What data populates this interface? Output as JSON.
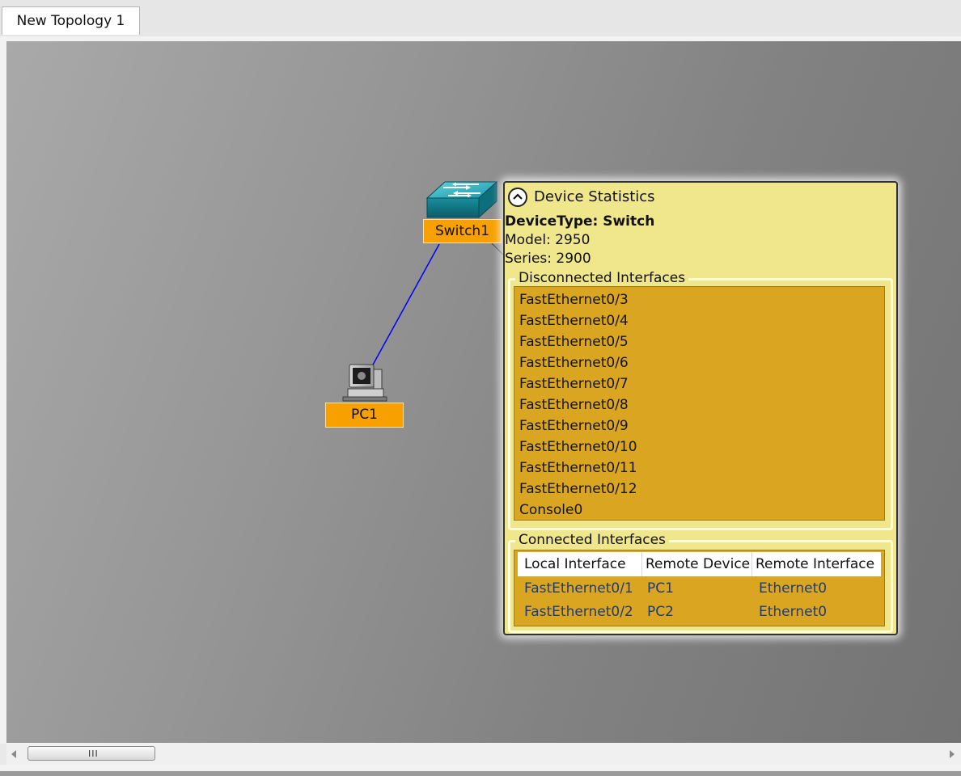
{
  "tabs": [
    {
      "label": "New Topology 1"
    }
  ],
  "devices": {
    "switch": {
      "label": "Switch1",
      "icon": "switch-icon"
    },
    "pc": {
      "label": "PC1",
      "icon": "pc-icon"
    }
  },
  "link": {
    "color": "#0000ff"
  },
  "stats_panel": {
    "title": "Device Statistics",
    "device_type_label": "DeviceType: Switch",
    "model_label": "Model: 2950",
    "series_label": "Series: 2900",
    "disconnected": {
      "title": "Disconnected Interfaces",
      "items": [
        "FastEthernet0/3",
        "FastEthernet0/4",
        "FastEthernet0/5",
        "FastEthernet0/6",
        "FastEthernet0/7",
        "FastEthernet0/8",
        "FastEthernet0/9",
        "FastEthernet0/10",
        "FastEthernet0/11",
        "FastEthernet0/12",
        "Console0"
      ]
    },
    "connected": {
      "title": "Connected Interfaces",
      "columns": [
        "Local Interface",
        "Remote Device",
        "Remote Interface"
      ],
      "rows": [
        [
          "FastEthernet0/1",
          "PC1",
          "Ethernet0"
        ],
        [
          "FastEthernet0/2",
          "PC2",
          "Ethernet0"
        ]
      ]
    }
  },
  "scrollbar": {
    "grip": "III"
  },
  "colors": {
    "label_bg": "#f7a000",
    "panel_bg": "#f0e68c",
    "list_bg": "#daa520",
    "table_text": "#1f3b77"
  }
}
